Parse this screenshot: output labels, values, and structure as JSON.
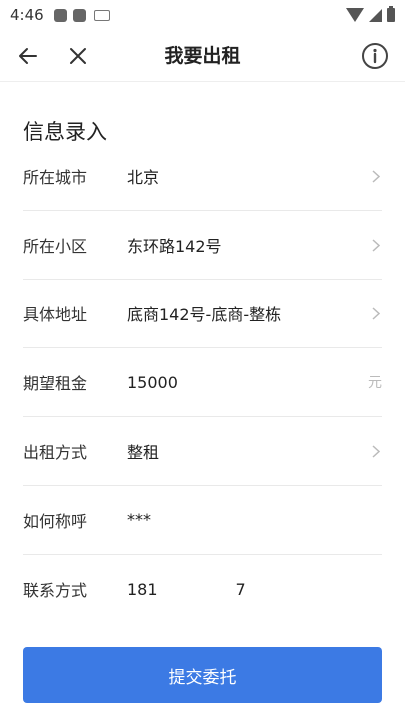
{
  "status_bar": {
    "time": "4:46",
    "icons": [
      "notification-icon",
      "notification-icon",
      "keyboard-icon",
      "wifi-icon",
      "signal-icon",
      "battery-icon"
    ]
  },
  "nav": {
    "title": "我要出租",
    "back_icon": "arrow-left-icon",
    "close_icon": "close-icon",
    "info_icon": "info-icon"
  },
  "section": {
    "title": "信息录入"
  },
  "form": {
    "city": {
      "label": "所在城市",
      "value": "北京"
    },
    "community": {
      "label": "所在小区",
      "value": "东环路142号"
    },
    "address": {
      "label": "具体地址",
      "value": "底商142号-底商-整栋"
    },
    "rent": {
      "label": "期望租金",
      "value": "15000",
      "unit": "元"
    },
    "rent_type": {
      "label": "出租方式",
      "value": "整租"
    },
    "name": {
      "label": "如何称呼",
      "value": "***"
    },
    "contact": {
      "label": "联系方式",
      "value_prefix": "181",
      "value_suffix": "7"
    }
  },
  "submit": {
    "label": "提交委托"
  },
  "colors": {
    "primary": "#3c7ae4",
    "divider": "#e9e9e9",
    "hint": "#bbbbbb"
  }
}
